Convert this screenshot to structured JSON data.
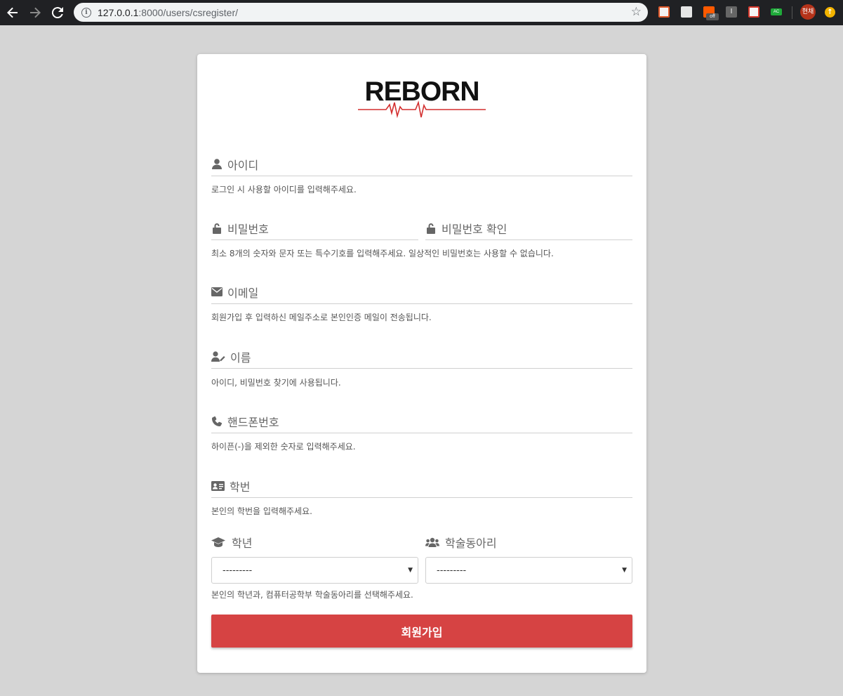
{
  "browser": {
    "url_host": "127.0.0.1",
    "url_rest": ":8000/users/csregister/",
    "ext_off_label": "off",
    "ext_i_label": "I",
    "ext_ac_label": "AC",
    "profile_label": "현채"
  },
  "logo": {
    "text": "REBORN",
    "accent": "#d32f2f"
  },
  "form": {
    "username": {
      "label": "아이디",
      "help": "로그인 시 사용할 아이디를 입력해주세요."
    },
    "password": {
      "label": "비밀번호"
    },
    "password_confirm": {
      "label": "비밀번호 확인"
    },
    "password_help": "최소 8개의 숫자와 문자 또는 특수기호를 입력해주세요. 일상적인 비밀번호는 사용할 수 없습니다.",
    "email": {
      "label": "이메일",
      "help": "회원가입 후 입력하신 메일주소로 본인인증 메일이 전송됩니다."
    },
    "name": {
      "label": "이름",
      "help": "아이디, 비밀번호 찾기에 사용됩니다."
    },
    "phone": {
      "label": "핸드폰번호",
      "help": "하이픈(-)을 제외한 숫자로 입력해주세요."
    },
    "student_id": {
      "label": "학번",
      "help": "본인의 학번을 입력해주세요."
    },
    "grade": {
      "label": "학년",
      "selected": "---------"
    },
    "club": {
      "label": "학술동아리",
      "selected": "---------"
    },
    "select_help": "본인의 학년과, 컴퓨터공학부 학술동아리를 선택해주세요.",
    "submit_label": "회원가입"
  },
  "colors": {
    "primary": "#d64343",
    "background": "#d5d5d5"
  }
}
